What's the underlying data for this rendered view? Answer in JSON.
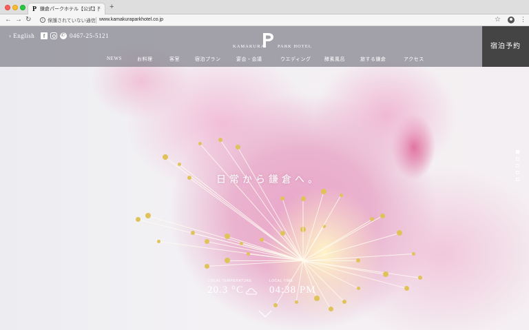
{
  "browser": {
    "tab_title": "鎌倉パークホテル【公式】| KA",
    "tab_favicon": "P",
    "tab_close": "×",
    "new_tab": "+",
    "security_text": "保護されていない通信",
    "url": "www.kamakuraparkhotel.co.jp",
    "icons": [
      "back-arrow-icon",
      "forward-arrow-icon",
      "reload-icon",
      "info-icon",
      "star-icon",
      "account-icon",
      "menu-dots-icon"
    ]
  },
  "header": {
    "english_link": "› English",
    "social_icons": [
      "facebook-icon",
      "instagram-icon",
      "phone-icon"
    ],
    "phone_number": "0467-25-5121",
    "logo": {
      "left": "KAMAKURA",
      "right": "PARK HOTEL",
      "mark": "P"
    },
    "nav": [
      {
        "label": "NEWS"
      },
      {
        "label": "お料理"
      },
      {
        "label": "客室"
      },
      {
        "label": "宿泊プラン"
      },
      {
        "label": "宴会・会議"
      },
      {
        "label": "ウエディング"
      },
      {
        "label": "酵素風呂"
      },
      {
        "label": "旅する鎌倉"
      },
      {
        "label": "アクセス"
      }
    ],
    "reserve_button": "宿泊予約"
  },
  "hero": {
    "catchcopy": "日常から鎌倉へ。",
    "slides_total": 5,
    "slides_active": 1
  },
  "weather": {
    "temp_label": "LOCAL TEMPERATURE",
    "temp_value": "20.3 °C",
    "time_label": "LOCAL TIME",
    "time_value": "04:38 PM",
    "weather_icon": "cloud-icon"
  },
  "colors": {
    "header_overlay": "#82828c",
    "reserve_bg": "#444444",
    "accent_pink": "#e9a6c9"
  }
}
